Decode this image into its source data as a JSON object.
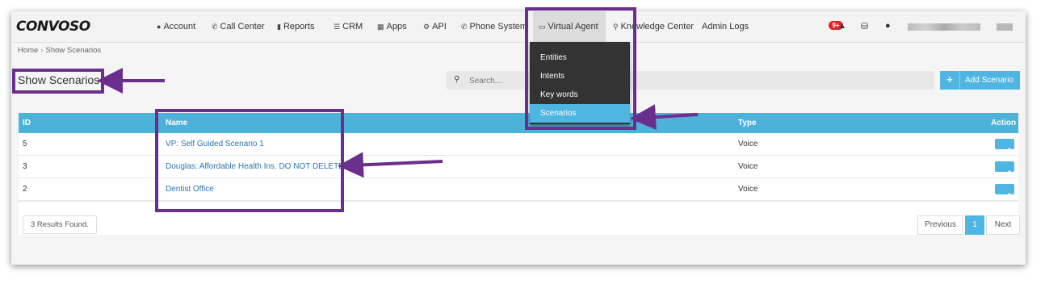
{
  "app": {
    "logo": "CONVOSO"
  },
  "nav": {
    "items": [
      {
        "icon": "user-icon",
        "label": "Account"
      },
      {
        "icon": "phone-icon",
        "label": "Call Center"
      },
      {
        "icon": "bar-chart-icon",
        "label": "Reports"
      },
      {
        "icon": "list-icon",
        "label": "CRM"
      },
      {
        "icon": "grid-icon",
        "label": "Apps"
      },
      {
        "icon": "gear-icon",
        "label": "API"
      },
      {
        "icon": "phone-icon",
        "label": "Phone System"
      },
      {
        "icon": "monitor-icon",
        "label": "Virtual Agent"
      },
      {
        "icon": "lightbulb-icon",
        "label": "Knowledge Center"
      },
      {
        "icon": "",
        "label": "Admin Logs"
      }
    ],
    "notification_count": "9+"
  },
  "breadcrumb": {
    "home": "Home",
    "current": "Show Scenarios"
  },
  "page": {
    "title": "Show Scenarios"
  },
  "search": {
    "placeholder": "Search..."
  },
  "add_button": {
    "label": "Add Scenario"
  },
  "dropdown": {
    "items": [
      "Entities",
      "Intents",
      "Key words",
      "Scenarios"
    ],
    "active": "Scenarios"
  },
  "table": {
    "headers": {
      "id": "ID",
      "name": "Name",
      "type": "Type",
      "action": "Action"
    },
    "rows": [
      {
        "id": "5",
        "name": "VP: Self Guided Scenario 1",
        "type": "Voice"
      },
      {
        "id": "3",
        "name": "Douglas: Affordable Health Ins. DO NOT DELETE",
        "type": "Voice"
      },
      {
        "id": "2",
        "name": "Dentist Office",
        "type": "Voice"
      }
    ]
  },
  "footer": {
    "results": "3 Results Found.",
    "pagination": {
      "previous": "Previous",
      "current": "1",
      "next": "Next"
    }
  },
  "colors": {
    "accent": "#4fb6e2",
    "header_bg": "#4db2da",
    "annotation": "#6a2f8d",
    "link": "#2a73b2"
  }
}
